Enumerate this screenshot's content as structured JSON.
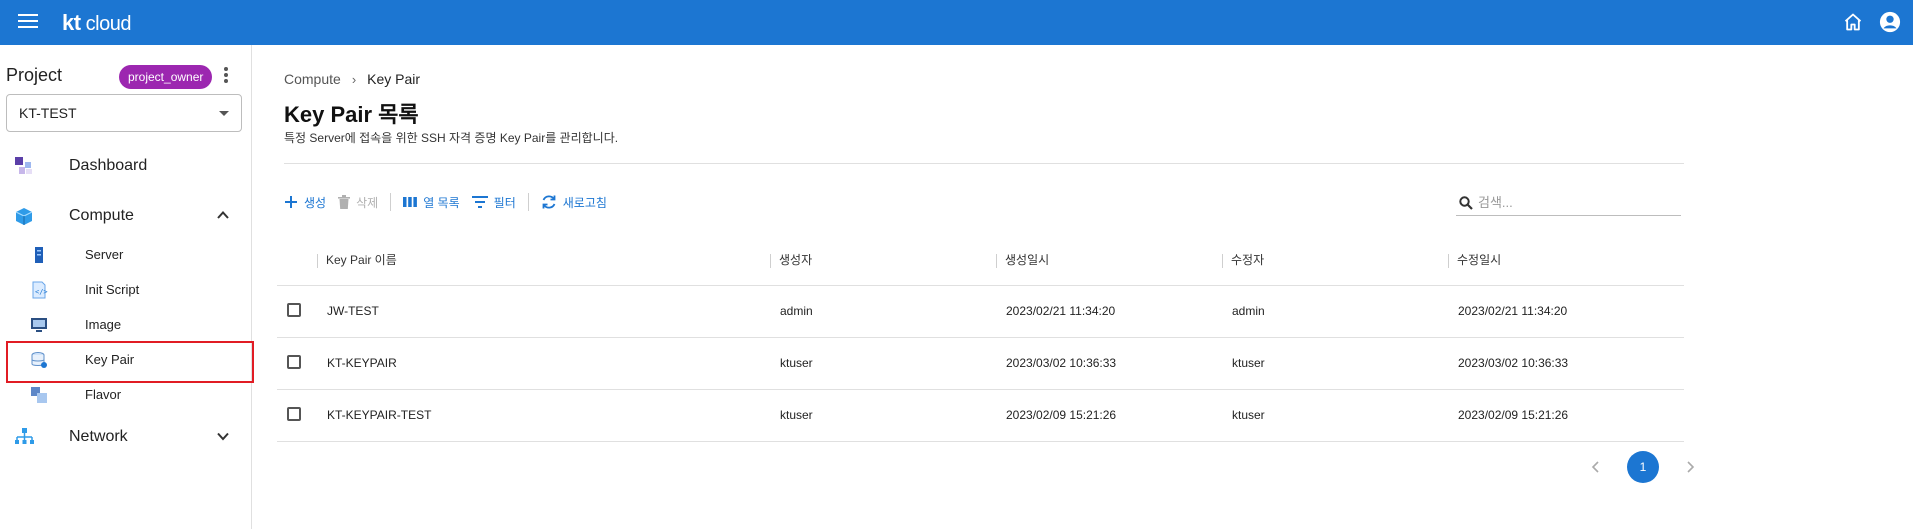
{
  "app": {
    "logo_prefix": "kt",
    "logo_suffix": "cloud",
    "brand_color": "#1c76d2"
  },
  "sidebar": {
    "project_label": "Project",
    "role_badge": "project_owner",
    "project_value": "KT-TEST",
    "nav": [
      {
        "label": "Dashboard",
        "icon": "dashboard-icon"
      },
      {
        "label": "Compute",
        "icon": "compute-icon",
        "expanded": true,
        "children": [
          {
            "label": "Server",
            "icon": "server-icon"
          },
          {
            "label": "Init Script",
            "icon": "script-icon"
          },
          {
            "label": "Image",
            "icon": "image-icon"
          },
          {
            "label": "Key Pair",
            "icon": "key-pair-icon",
            "selected": true
          },
          {
            "label": "Flavor",
            "icon": "flavor-icon"
          }
        ]
      },
      {
        "label": "Network",
        "icon": "network-icon",
        "expanded": false
      }
    ]
  },
  "main": {
    "breadcrumb": [
      "Compute",
      "Key Pair"
    ],
    "title": "Key Pair 목록",
    "description": "특정 Server에 접속을 위한 SSH 자격 증명 Key Pair를 관리합니다.",
    "toolbar": {
      "create": "생성",
      "delete": "삭제",
      "columns": "열 목록",
      "filter": "필터",
      "refresh": "새로고침"
    },
    "search_placeholder": "검색...",
    "table": {
      "headers": [
        "Key Pair 이름",
        "생성자",
        "생성일시",
        "수정자",
        "수정일시"
      ],
      "rows": [
        [
          "JW-TEST",
          "admin",
          "2023/02/21 11:34:20",
          "admin",
          "2023/02/21 11:34:20"
        ],
        [
          "KT-KEYPAIR",
          "ktuser",
          "2023/03/02 10:36:33",
          "ktuser",
          "2023/03/02 10:36:33"
        ],
        [
          "KT-KEYPAIR-TEST",
          "ktuser",
          "2023/02/09 15:21:26",
          "ktuser",
          "2023/02/09 15:21:26"
        ]
      ]
    },
    "pagination": {
      "current_page": "1"
    }
  }
}
